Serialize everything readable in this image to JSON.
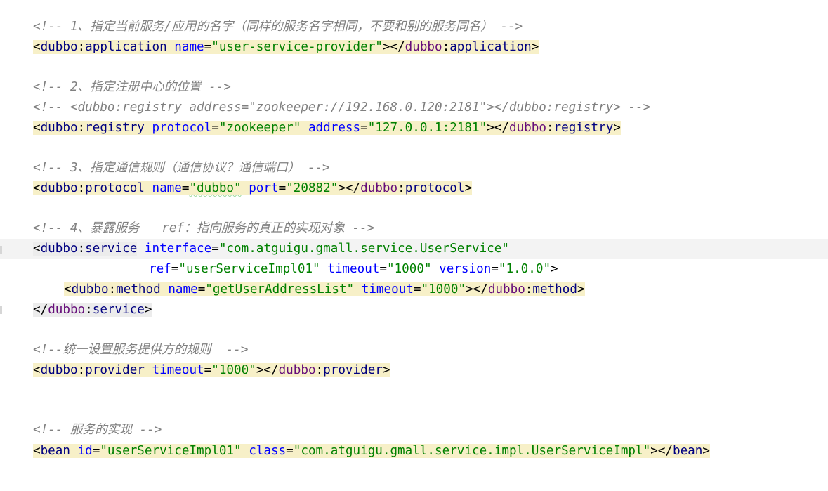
{
  "editor": {
    "comments": {
      "c1": "<!-- 1、指定当前服务/应用的名字（同样的服务名字相同，不要和别的服务同名） -->",
      "c2": "<!-- 2、指定注册中心的位置 -->",
      "c2b": "<!-- <dubbo:registry address=\"zookeeper://192.168.0.120:2181\"></dubbo:registry> -->",
      "c3": "<!-- 3、指定通信规则（通信协议？通信端口） -->",
      "c4": "<!-- 4、暴露服务   ref：指向服务的真正的实现对象 -->",
      "c5": "<!--统一设置服务提供方的规则  -->",
      "c6": "<!-- 服务的实现 -->"
    },
    "application": {
      "open_ns": "dubbo",
      "name": "application",
      "attr_name": "name",
      "val_name": "\"user-service-provider\""
    },
    "registry": {
      "ns": "dubbo",
      "name": "registry",
      "attr_protocol": "protocol",
      "val_protocol": "\"zookeeper\"",
      "attr_address": "address",
      "val_address": "\"127.0.0.1:2181\""
    },
    "protocol": {
      "ns": "dubbo",
      "name": "protocol",
      "attr_name": "name",
      "val_name": "\"dubbo\"",
      "attr_port": "port",
      "val_port": "\"20882\""
    },
    "service": {
      "ns": "dubbo",
      "name": "service",
      "attr_interface": "interface",
      "val_interface": "\"com.atguigu.gmall.service.UserService\"",
      "attr_ref": "ref",
      "val_ref": "\"userServiceImpl01\"",
      "attr_timeout": "timeout",
      "val_timeout": "\"1000\"",
      "attr_version": "version",
      "val_version": "\"1.0.0\""
    },
    "method": {
      "ns": "dubbo",
      "name": "method",
      "attr_name": "name",
      "val_name": "\"getUserAddressList\"",
      "attr_timeout": "timeout",
      "val_timeout": "\"1000\""
    },
    "provider": {
      "ns": "dubbo",
      "name": "provider",
      "attr_timeout": "timeout",
      "val_timeout": "\"1000\""
    },
    "bean": {
      "name": "bean",
      "attr_id": "id",
      "val_id": "\"userServiceImpl01\"",
      "attr_class": "class",
      "val_class": "\"com.atguigu.gmall.service.impl.UserServiceImpl\""
    },
    "punct": {
      "lt": "<",
      "gt": ">",
      "lts": "</",
      "colon": ":",
      "eq": "="
    }
  }
}
